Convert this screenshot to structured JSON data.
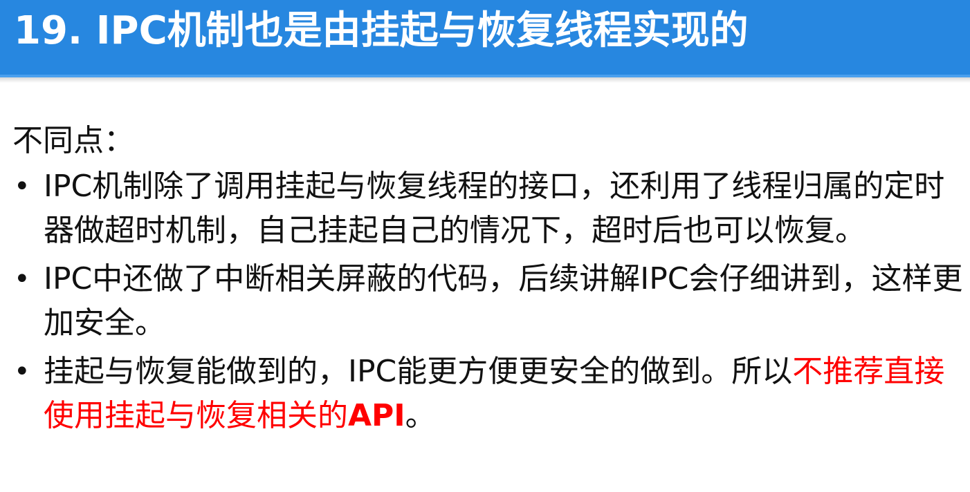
{
  "slide": {
    "title": "19. IPC机制也是由挂起与恢复线程实现的",
    "heading": "不同点：",
    "bullet_symbol": "•",
    "points": [
      {
        "text": "IPC机制除了调用挂起与恢复线程的接口，还利用了线程归属的定时器做超时机制，自己挂起自己的情况下，超时后也可以恢复。"
      },
      {
        "text": "IPC中还做了中断相关屏蔽的代码，后续讲解IPC会仔细讲到，这样更加安全。"
      },
      {
        "text_normal": "挂起与恢复能做到的，IPC能更方便更安全的做到。所以",
        "text_red": "不推荐直接使用挂起与恢复相关的",
        "text_red_bold": "API",
        "text_end": "。"
      }
    ]
  },
  "colors": {
    "title_bar": "#2787e0",
    "title_text": "#ffffff",
    "body_text": "#111111",
    "emphasis": "#ff0000"
  }
}
